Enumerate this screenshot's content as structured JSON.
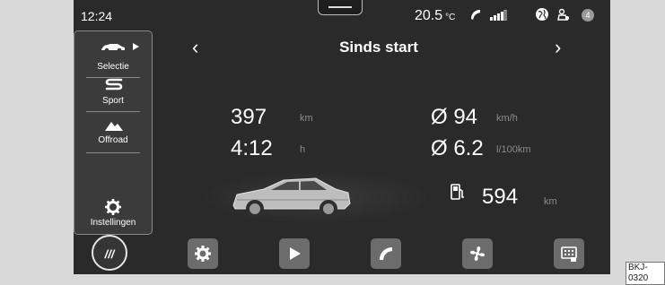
{
  "status": {
    "time": "12:24",
    "temperature": "20.5",
    "temp_unit": "°C",
    "badge": "4"
  },
  "sidebar": {
    "modes": [
      {
        "label": "Selectie"
      },
      {
        "label": "Sport"
      },
      {
        "label": "Offroad"
      }
    ],
    "settings_label": "Instellingen"
  },
  "title": "Sinds start",
  "metrics": {
    "distance": {
      "value": "397",
      "unit": "km"
    },
    "duration": {
      "value": "4:12",
      "unit": "h"
    },
    "avg_speed": {
      "value": "Ø 94",
      "unit": "km/h"
    },
    "avg_consumption": {
      "value": "Ø 6.2",
      "unit": "l/100km"
    },
    "range": {
      "value": "594",
      "unit": "km"
    }
  },
  "dock": {
    "menu_label": "///"
  },
  "figure_code": "BKJ-0320"
}
